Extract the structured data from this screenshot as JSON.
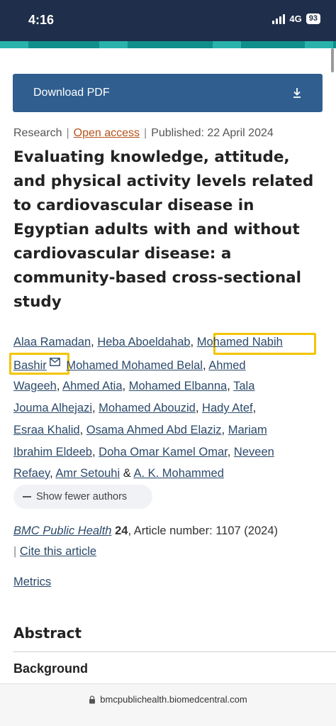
{
  "status_bar": {
    "time": "4:16",
    "network": "4G",
    "battery": "93"
  },
  "toolbar": {
    "download_label": "Download PDF"
  },
  "meta": {
    "type": "Research",
    "access": "Open access",
    "published": "Published: 22 April 2024"
  },
  "article": {
    "title_lines": [
      "Evaluating knowledge, attitude,",
      "and physical activity levels related",
      "to cardiovascular disease in",
      "Egyptian adults with and without",
      "cardiovascular disease: a",
      "community-based cross-sectional",
      "study"
    ]
  },
  "authors": {
    "a1": "Alaa Ramadan",
    "a2": "Heba Aboeldahab",
    "a3_part1": "Mohamed Nabih",
    "a3_part2": "Bashir",
    "a4": "Mohamed Mohamed Belal",
    "a5_part1": "Ahmed",
    "a5_part2": "Wageeh",
    "a6": "Ahmed Atia",
    "a7": "Mohamed Elbanna",
    "a8_part1": "Tala",
    "a8_part2": "Jouma Alhejazi",
    "a9": "Mohamed Abouzid",
    "a10": "Hady Atef",
    "a11": "Esraa Khalid",
    "a12": "Osama Ahmed Abd Elaziz",
    "a13_part1": "Mariam",
    "a13_part2": "Ibrahim Eldeeb",
    "a14": "Doha Omar Kamel Omar",
    "a15_part1": "Neveen",
    "a15_part2": "Refaey",
    "a16": "Amr Setouhi",
    "a17": "A. K. Mohammed",
    "comma": ",",
    "ampersand": "&",
    "show_fewer_label": "Show fewer authors",
    "highlight_color": "#f2c500"
  },
  "citation": {
    "journal": "BMC Public Health",
    "volume": "24",
    "article_number": ", Article number: 1107 (2024)",
    "cite_label": "Cite this article"
  },
  "metrics_label": "Metrics",
  "abstract": {
    "heading": "Abstract",
    "subheading": "Background"
  },
  "url_bar": {
    "url": "bmcpublichealth.biomedcentral.com"
  },
  "colors": {
    "status_bar": "#1f2e4a",
    "accent_teal": "#0f8f8c",
    "button": "#2f5e8f",
    "link": "#2c4a6b",
    "open_access": "#b5521b"
  },
  "icons": [
    "download-icon",
    "mail-icon",
    "lock-icon",
    "signal-icon"
  ]
}
